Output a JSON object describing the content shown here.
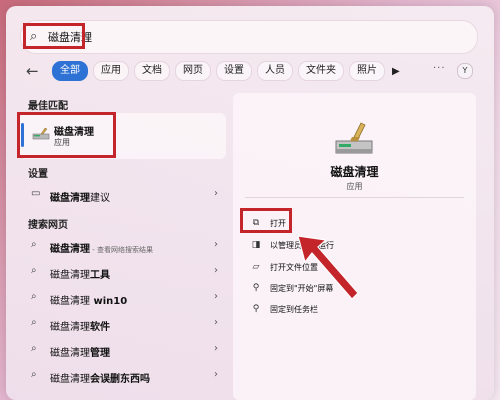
{
  "search": {
    "icon": "search-icon",
    "query": "磁盘清理"
  },
  "filters": {
    "back_icon": "back-arrow-icon",
    "chips": [
      "全部",
      "应用",
      "文档",
      "网页",
      "设置",
      "人员",
      "文件夹",
      "照片"
    ],
    "active_index": 0,
    "play_icon": "play-icon",
    "more": "···",
    "avatar": "Y"
  },
  "left": {
    "best_match_title": "最佳匹配",
    "best_match": {
      "title": "磁盘清理",
      "subtitle": "应用",
      "icon": "disk-cleanup-icon"
    },
    "settings_title": "设置",
    "settings_item": {
      "bold": "磁盘清理",
      "rest": "建议",
      "icon": "drive-icon"
    },
    "web_title": "搜索网页",
    "web_items": [
      {
        "bold": "磁盘清理",
        "rest": "",
        "hint": " - 查看网络搜索结果"
      },
      {
        "bold": "磁盘清理",
        "rest": "工具",
        "hint": ""
      },
      {
        "bold": "磁盘清理",
        "rest": " win10",
        "hint": ""
      },
      {
        "bold": "磁盘清理",
        "rest": "软件",
        "hint": ""
      },
      {
        "bold": "磁盘清理",
        "rest": "管理",
        "hint": ""
      },
      {
        "bold": "磁盘清理",
        "rest": "会误删东西吗",
        "hint": ""
      }
    ]
  },
  "detail": {
    "title": "磁盘清理",
    "subtitle": "应用",
    "actions": [
      {
        "label": "打开",
        "icon": "open-icon"
      },
      {
        "label": "以管理员身份运行",
        "icon": "admin-shield-icon"
      },
      {
        "label": "打开文件位置",
        "icon": "folder-icon"
      },
      {
        "label": "固定到\"开始\"屏幕",
        "icon": "pin-icon"
      },
      {
        "label": "固定到任务栏",
        "icon": "pin-icon"
      }
    ]
  },
  "colors": {
    "accent": "#2f72d6",
    "highlight": "#c3252a"
  }
}
